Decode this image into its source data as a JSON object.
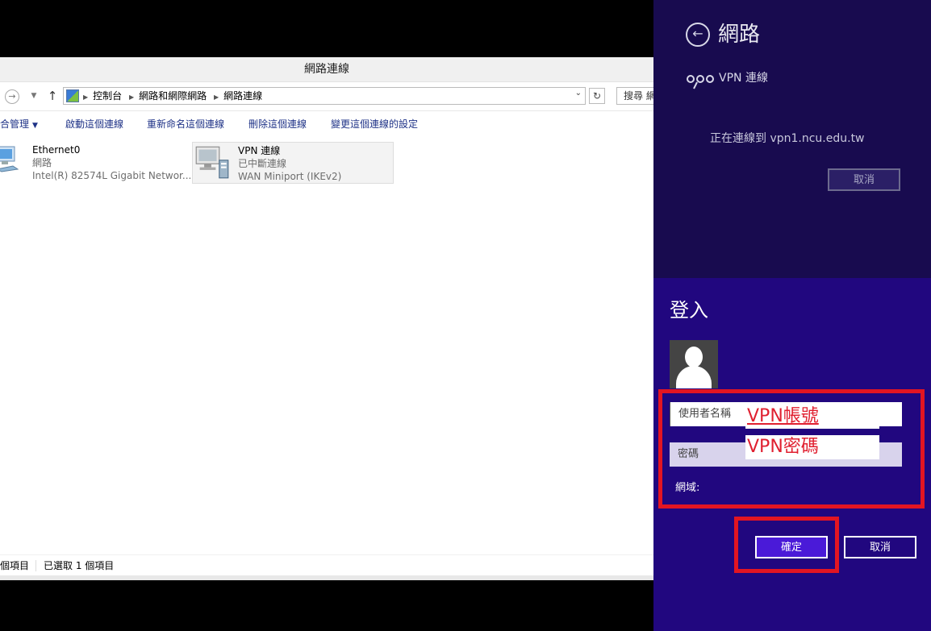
{
  "explorer": {
    "window_title": "網路連線",
    "breadcrumbs": [
      "控制台",
      "網路和網際網路",
      "網路連線"
    ],
    "search_placeholder": "搜尋 網",
    "commands": {
      "organize": "合管理",
      "start": "啟動這個連線",
      "rename": "重新命名這個連線",
      "delete": "刪除這個連線",
      "change": "變更這個連線的設定"
    },
    "connections": [
      {
        "name": "Ethernet0",
        "status": "網路",
        "device": "Intel(R) 82574L Gigabit Networ..."
      },
      {
        "name": "VPN 連線",
        "status": "已中斷連線",
        "device": "WAN Miniport (IKEv2)"
      }
    ],
    "status_bar": {
      "items": "個項目",
      "selected": "已選取 1 個項目"
    }
  },
  "charm": {
    "title": "網路",
    "vpn_label": "VPN 連線",
    "connecting_text": "正在連線到 vpn1.ncu.edu.tw",
    "cancel_top": "取消"
  },
  "login": {
    "title": "登入",
    "username_placeholder": "使用者名稱",
    "password_placeholder": "密碼",
    "domain_label": "網域:",
    "ok_label": "確定",
    "cancel_label": "取消",
    "annotation_user": "VPN帳號",
    "annotation_pass": "VPN密碼"
  },
  "colors": {
    "charm_bg": "#180b4f",
    "login_bg": "#21077f",
    "highlight_red": "#e31522",
    "ok_button": "#4a1ad8"
  }
}
